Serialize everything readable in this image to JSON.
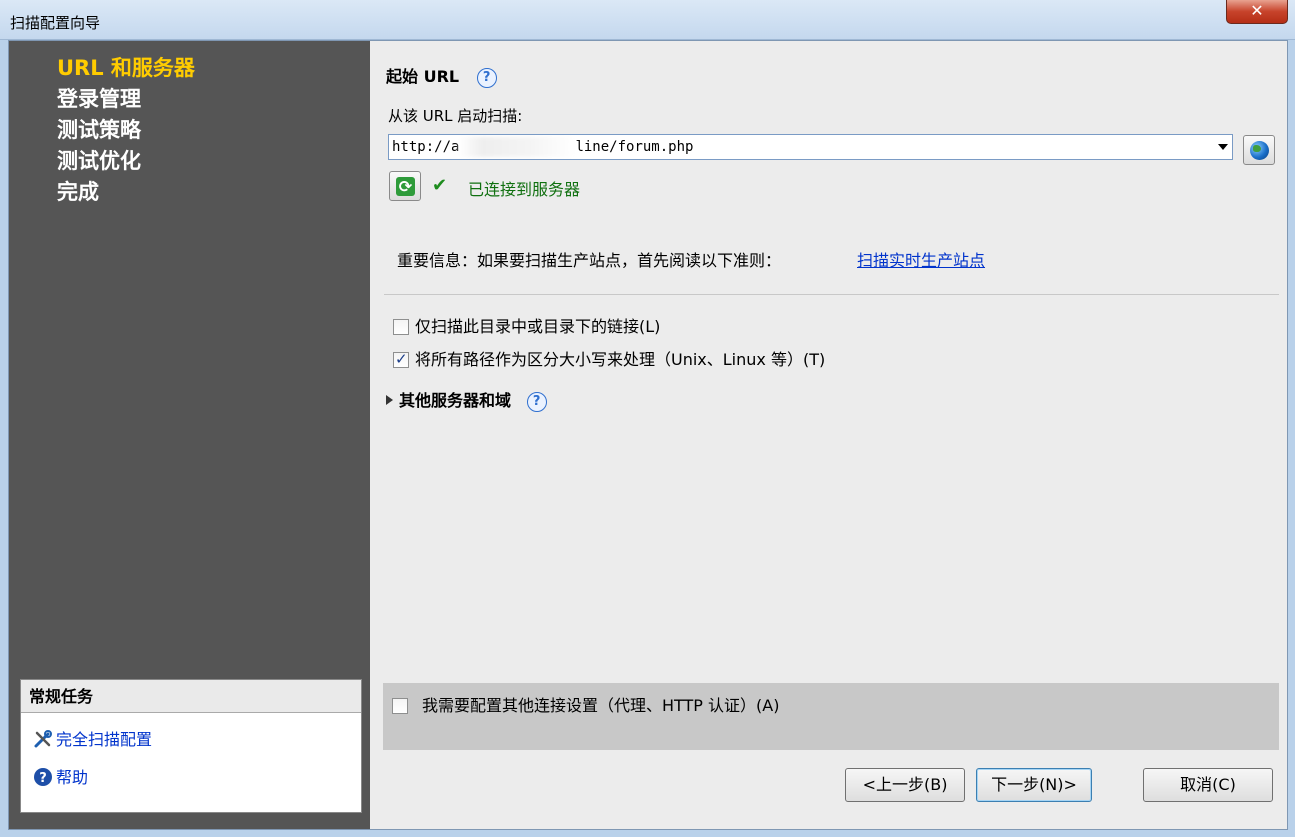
{
  "window": {
    "title": "扫描配置向导",
    "close_label": "✕"
  },
  "nav": {
    "items": [
      {
        "label": "URL 和服务器"
      },
      {
        "label": "登录管理"
      },
      {
        "label": "测试策略"
      },
      {
        "label": "测试优化"
      },
      {
        "label": "完成"
      }
    ]
  },
  "tasks": {
    "header": "常规任务",
    "items": [
      {
        "label": "完全扫描配置",
        "icon": "tools-icon"
      },
      {
        "label": "帮助",
        "icon": "help-icon"
      }
    ]
  },
  "main": {
    "section_title": "起始 URL",
    "help_glyph": "?",
    "url_label": "从该 URL 启动扫描:",
    "url_value_start": "http://a",
    "url_value_end": "line/forum.php",
    "status": "已连接到服务器",
    "notice": "重要信息：如果要扫描生产站点，首先阅读以下准则：",
    "notice_link": "扫描实时生产站点",
    "option_scan_dir": "仅扫描此目录中或目录下的链接(L)",
    "option_scan_dir_checked": false,
    "option_case": "将所有路径作为区分大小写来处理（Unix、Linux 等）(T)",
    "option_case_checked": true,
    "expander": "其他服务器和域",
    "bottom_option": "我需要配置其他连接设置（代理、HTTP 认证）(A)",
    "bottom_option_checked": false
  },
  "buttons": {
    "back": "<上一步(B)",
    "next": "下一步(N)>",
    "cancel": "取消(C)"
  }
}
